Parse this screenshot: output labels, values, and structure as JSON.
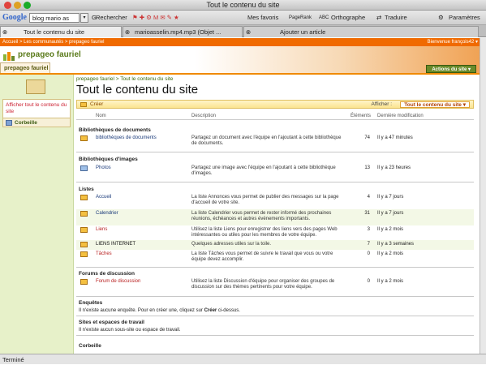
{
  "window": {
    "title": "Tout le contenu du site"
  },
  "google_bar": {
    "logo": "Google",
    "query": "blog mario as",
    "search_label": "Rechercher",
    "favorites_label": "Mes favoris",
    "pagerank_label": "PageRank",
    "spell_label": "Orthographe",
    "translate_label": "Traduire",
    "settings_label": "Paramètres"
  },
  "tabs": [
    {
      "label": "Tout le contenu du site"
    },
    {
      "label": "marioasselin.mp4.mp3 (Objet ..."
    },
    {
      "label": "Ajouter un article"
    }
  ],
  "top_crumb": {
    "text": "Accueil > Les communautés > prepageo fauriel",
    "welcome": "Bienvenue françois42 ▾"
  },
  "header": {
    "site_name": "prepageo fauriel",
    "site_tab": "prepageo fauriel",
    "actions_label": "Actions du site ▾"
  },
  "left_nav": {
    "view_all": "Afficher tout le contenu du site",
    "recycle": "Corbeille"
  },
  "page": {
    "breadcrumb": "prepageo fauriel > Tout le contenu du site",
    "title": "Tout le contenu du site",
    "create_label": "Créer",
    "show_label": "Afficher :",
    "view_label": "Tout le contenu du site ▾"
  },
  "columns": {
    "name": "Nom",
    "description": "Description",
    "items": "Éléments",
    "modified": "Dernière modification"
  },
  "sections": {
    "doc_libs": {
      "title": "Bibliothèques de documents",
      "rows": [
        {
          "name": "bibliothèques de documents",
          "desc": "Partagez un document avec l'équipe en l'ajoutant à cette bibliothèque de documents.",
          "count": "74",
          "date": "Il y a 47 minutes"
        }
      ]
    },
    "img_libs": {
      "title": "Bibliothèques d'images",
      "rows": [
        {
          "name": "Photos",
          "desc": "Partagez une image avec l'équipe en l'ajoutant à cette bibliothèque d'images.",
          "count": "13",
          "date": "Il y a 23 heures"
        }
      ]
    },
    "lists": {
      "title": "Listes",
      "rows": [
        {
          "name": "Accueil",
          "desc": "La liste Annonces vous permet de publier des messages sur la page d'accueil de votre site.",
          "count": "4",
          "date": "Il y a 7 jours"
        },
        {
          "name": "Calendrier",
          "desc": "La liste Calendrier vous permet de rester informé des prochaines réunions, échéances et autres événements importants.",
          "count": "31",
          "date": "Il y a 7 jours"
        },
        {
          "name": "Liens",
          "desc": "Utilisez la liste Liens pour enregistrer des liens vers des pages Web intéressantes ou utiles pour les membres de votre équipe.",
          "count": "3",
          "date": "Il y a 2 mois"
        },
        {
          "name": "LIENS INTERNET",
          "desc": "Quelques adresses utiles sur la toile.",
          "count": "7",
          "date": "Il y a 3 semaines"
        },
        {
          "name": "Tâches",
          "desc": "La liste Tâches vous permet de suivre le travail que vous ou votre équipe devez accomplir.",
          "count": "0",
          "date": "Il y a 2 mois"
        }
      ]
    },
    "forums": {
      "title": "Forums de discussion",
      "rows": [
        {
          "name": "Forum de discussion",
          "desc": "Utilisez la liste Discussion d'équipe pour organiser des groupes de discussion sur des thèmes pertinents pour votre équipe.",
          "count": "0",
          "date": "Il y a 2 mois"
        }
      ]
    },
    "surveys": {
      "title": "Enquêtes",
      "note_a": "Il n'existe aucune enquête. Pour en créer une, cliquez sur ",
      "note_b": "Créer",
      "note_c": " ci-dessus."
    },
    "sites": {
      "title": "Sites et espaces de travail",
      "note": "Il n'existe aucun sous-site ou espace de travail."
    },
    "recycle": {
      "title": "Corbeille"
    }
  },
  "status": {
    "text": "Terminé"
  }
}
